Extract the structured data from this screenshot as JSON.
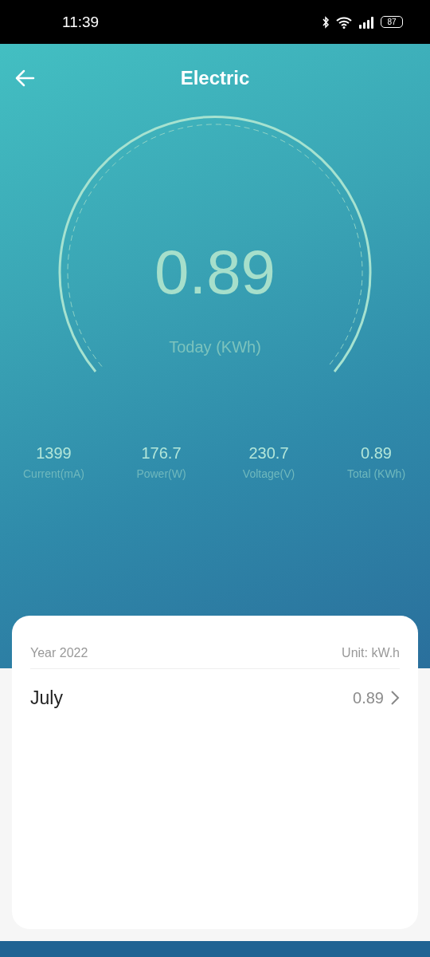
{
  "status_bar": {
    "time": "11:39",
    "battery": "87"
  },
  "header": {
    "title": "Electric"
  },
  "gauge": {
    "value": "0.89",
    "label": "Today (KWh)"
  },
  "stats": [
    {
      "value": "1399",
      "label": "Current(mA)"
    },
    {
      "value": "176.7",
      "label": "Power(W)"
    },
    {
      "value": "230.7",
      "label": "Voltage(V)"
    },
    {
      "value": "0.89",
      "label": "Total (KWh)"
    }
  ],
  "history": {
    "year": "Year 2022",
    "unit": "Unit: kW.h",
    "rows": [
      {
        "month": "July",
        "value": "0.89"
      }
    ]
  }
}
